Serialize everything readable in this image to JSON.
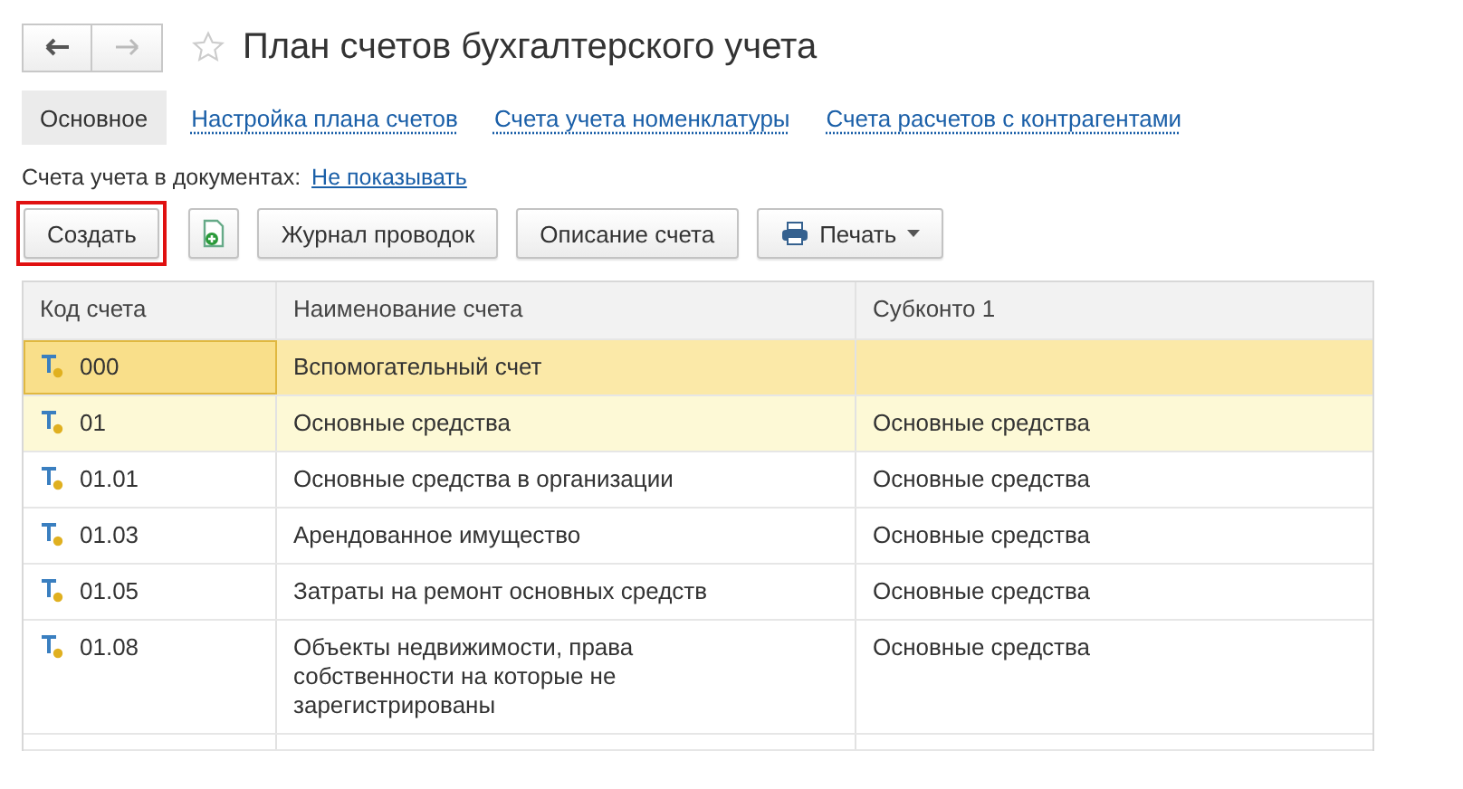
{
  "window": {
    "title": "План счетов бухгалтерского учета",
    "favorite": false
  },
  "tabs": [
    {
      "label": "Основное",
      "selected": true
    },
    {
      "label": "Настройка плана счетов",
      "selected": false
    },
    {
      "label": "Счета учета номенклатуры",
      "selected": false
    },
    {
      "label": "Счета расчетов с контрагентами",
      "selected": false
    }
  ],
  "documents_accounts": {
    "label": "Счета учета в документах:",
    "link": "Не показывать"
  },
  "toolbar": [
    {
      "kind": "text",
      "label": "Создать",
      "highlighted": true
    },
    {
      "kind": "icon",
      "highlighted": false
    },
    {
      "kind": "text",
      "label": "Журнал проводок",
      "highlighted": false
    },
    {
      "kind": "text",
      "label": "Описание счета",
      "highlighted": false
    },
    {
      "kind": "menu",
      "label": "Печать",
      "highlighted": false
    }
  ],
  "table": {
    "columns": [
      "Код счета",
      "Наименование счета",
      "Субконто 1"
    ],
    "rows": [
      {
        "code": "000",
        "name": "Вспомогательный счет",
        "subconto_1": "",
        "selected": true,
        "highlighted": false
      },
      {
        "code": "01",
        "name": "Основные средства",
        "subconto_1": "Основные средства",
        "selected": false,
        "highlighted": true
      },
      {
        "code": "01.01",
        "name": "Основные средства в организации",
        "subconto_1": "Основные средства",
        "selected": false,
        "highlighted": false
      },
      {
        "code": "01.03",
        "name": "Арендованное имущество",
        "subconto_1": "Основные средства",
        "selected": false,
        "highlighted": false
      },
      {
        "code": "01.05",
        "name": "Затраты на ремонт основных средств",
        "subconto_1": "Основные средства",
        "selected": false,
        "highlighted": false
      },
      {
        "code": "01.08",
        "name": "Объекты недвижимости, права собственности на которые не зарегистрированы",
        "subconto_1": "Основные средства",
        "selected": false,
        "highlighted": false
      }
    ]
  }
}
